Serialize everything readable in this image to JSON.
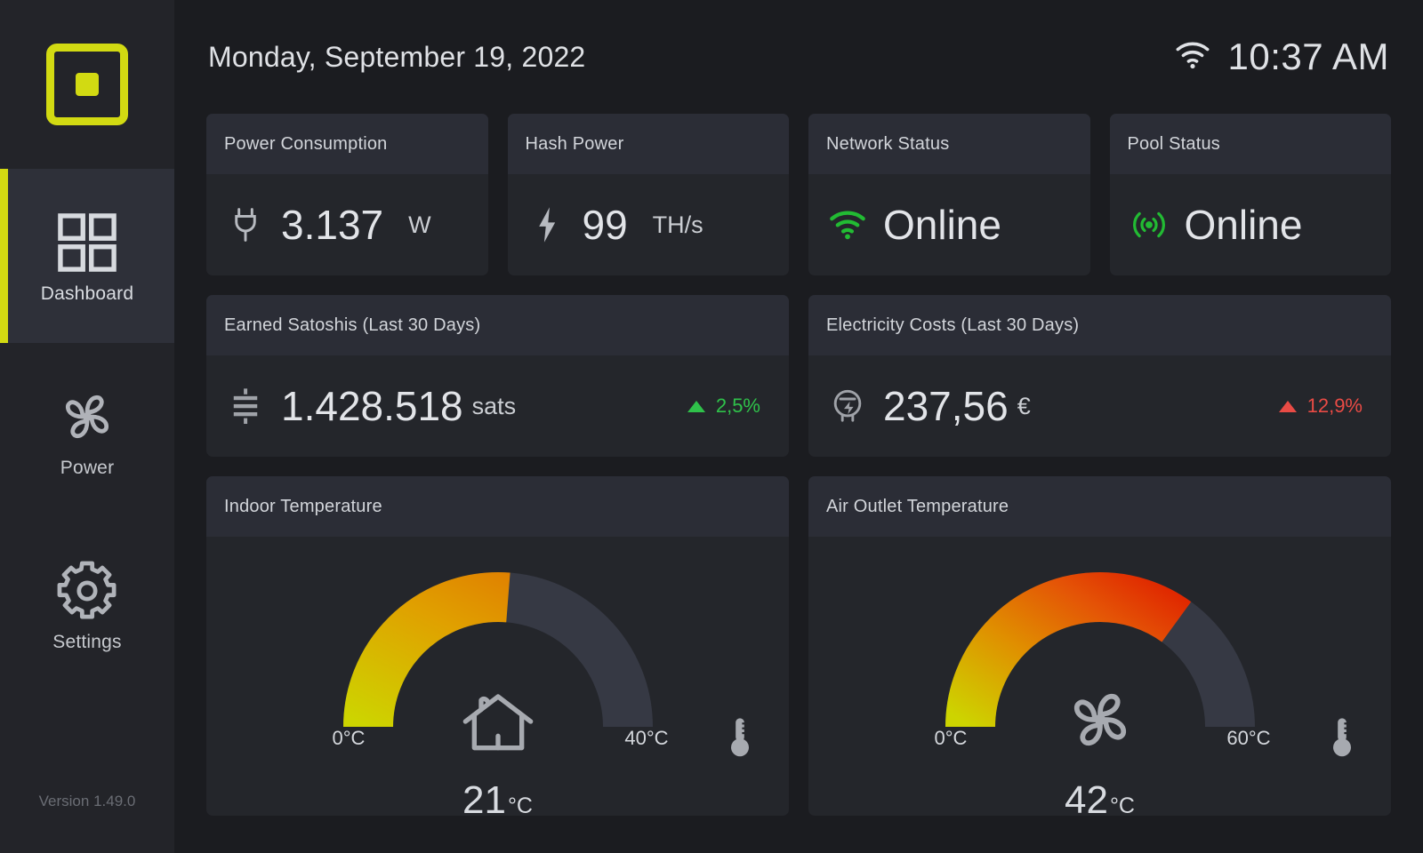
{
  "sidebar": {
    "logo": "square-logo-icon",
    "items": [
      {
        "label": "Dashboard",
        "icon": "grid-icon",
        "active": true
      },
      {
        "label": "Power",
        "icon": "fan-icon",
        "active": false
      },
      {
        "label": "Settings",
        "icon": "gear-icon",
        "active": false
      }
    ],
    "version": "Version 1.49.0",
    "accent_color": "#d2da12"
  },
  "header": {
    "date": "Monday, September 19, 2022",
    "time": "10:37 AM",
    "wifi_icon": "wifi-icon"
  },
  "stats": [
    {
      "title": "Power Consumption",
      "icon": "plug-icon",
      "value": "3.137",
      "unit": "W"
    },
    {
      "title": "Hash Power",
      "icon": "lightning-bolt-icon",
      "value": "99",
      "unit": "TH/s"
    },
    {
      "title": "Network Status",
      "icon": "wifi-icon",
      "icon_color": "#22bb33",
      "value": "Online",
      "unit": ""
    },
    {
      "title": "Pool Status",
      "icon": "broadcast-icon",
      "icon_color": "#22bb33",
      "value": "Online",
      "unit": ""
    }
  ],
  "metrics": [
    {
      "title": "Earned Satoshis (Last 30 Days)",
      "icon": "satoshi-icon",
      "value": "1.428.518",
      "unit": "sats",
      "delta": "2,5%",
      "delta_direction": "up",
      "delta_color": "#2fc14a"
    },
    {
      "title": "Electricity Costs (Last 30 Days)",
      "icon": "electric-meter-icon",
      "value": "237,56",
      "unit": "€",
      "delta": "12,9%",
      "delta_direction": "up",
      "delta_color": "#e94b45"
    }
  ],
  "gauges": [
    {
      "title": "Indoor Temperature",
      "center_icon": "house-icon",
      "min_label": "0°C",
      "max_label": "40°C",
      "value": "21",
      "value_unit": "°C",
      "side_icon": "thermometer-icon"
    },
    {
      "title": "Air Outlet Temperature",
      "center_icon": "fan-icon",
      "min_label": "0°C",
      "max_label": "60°C",
      "value": "42",
      "value_unit": "°C",
      "side_icon": "thermometer-icon"
    }
  ],
  "chart_data": [
    {
      "type": "gauge",
      "title": "Indoor Temperature",
      "value": 21,
      "min": 0,
      "max": 40,
      "unit": "°C",
      "fill_fraction": 0.525,
      "gradient": [
        "#cdd400",
        "#e08000"
      ],
      "track_color": "#363944",
      "tick_labels": [
        "0°C",
        "40°C"
      ]
    },
    {
      "type": "gauge",
      "title": "Air Outlet Temperature",
      "value": 42,
      "min": 0,
      "max": 60,
      "unit": "°C",
      "fill_fraction": 0.7,
      "gradient": [
        "#cdd400",
        "#e6700a",
        "#e03000"
      ],
      "track_color": "#363944",
      "tick_labels": [
        "0°C",
        "60°C"
      ]
    }
  ]
}
